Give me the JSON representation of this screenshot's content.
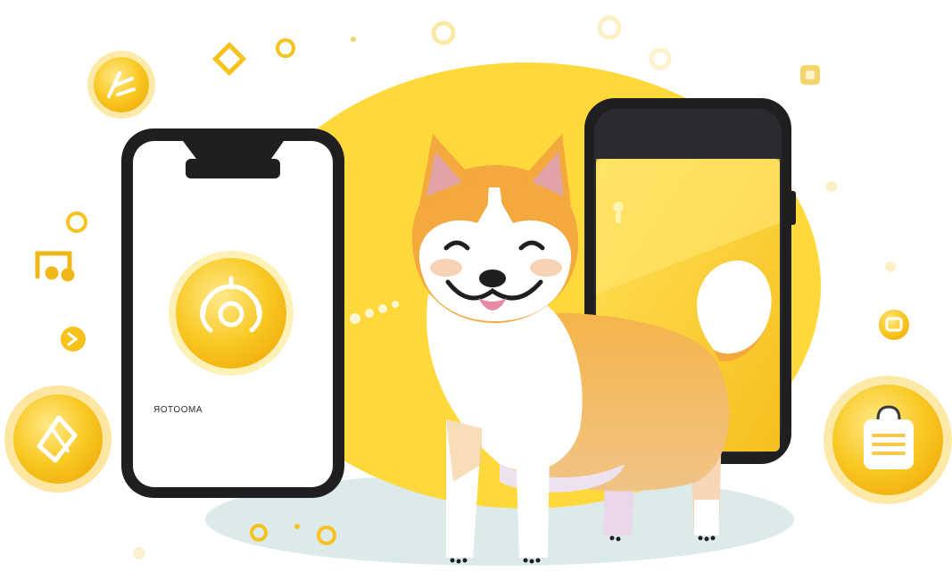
{
  "left_phone": {
    "caption": "ЯOTOOMA"
  },
  "palette": {
    "blob": "#ffd83a",
    "coin": "#f8c21c",
    "coin_light": "#ffe16a",
    "dog_orange": "#f3a93d",
    "dog_white": "#ffffff",
    "phone_frame": "#1f1f22",
    "ground": "#d7e7e6"
  },
  "icons": [
    "diamond-icon",
    "coin-icon",
    "music-note-icon",
    "clipboard-icon",
    "dog-mascot-icon"
  ]
}
